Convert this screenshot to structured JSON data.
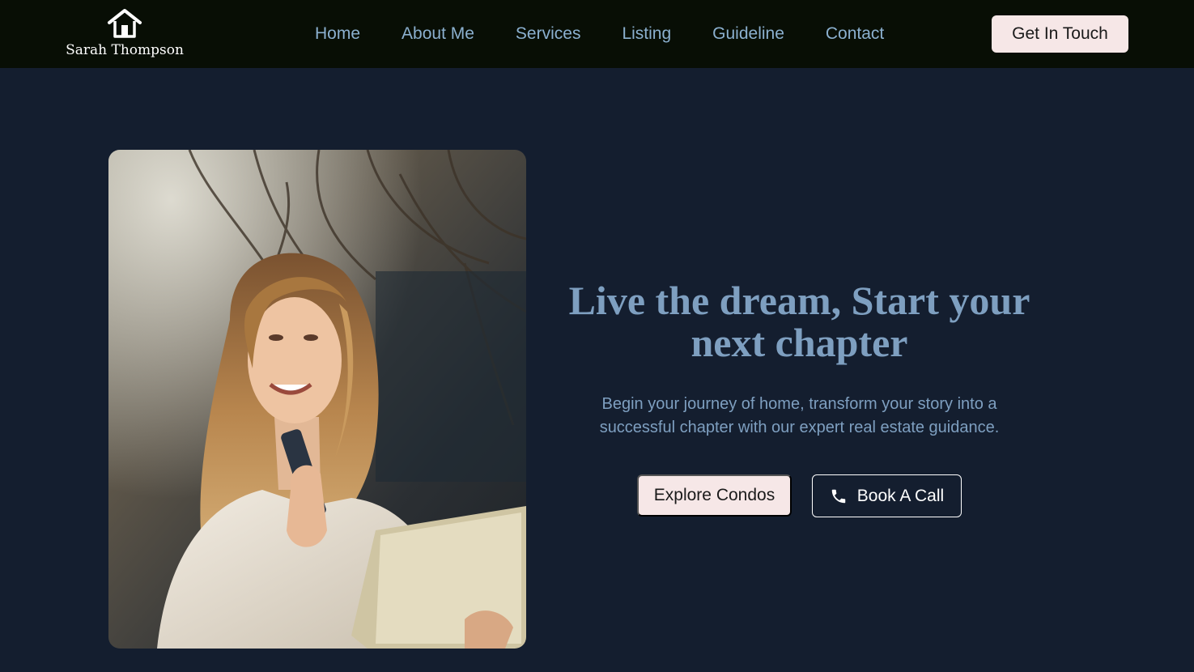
{
  "brand": {
    "name": "Sarah Thompson",
    "icon": "house-icon"
  },
  "nav": {
    "items": [
      {
        "label": "Home"
      },
      {
        "label": "About Me"
      },
      {
        "label": "Services"
      },
      {
        "label": "Listing"
      },
      {
        "label": "Guideline"
      },
      {
        "label": "Contact"
      }
    ],
    "cta_label": "Get In Touch"
  },
  "hero": {
    "title": "Live the dream, Start your next chapter",
    "subtitle": "Begin your journey of home, transform your story into a successful chapter with our expert real estate guidance.",
    "primary_button": "Explore Condos",
    "secondary_button": "Book A Call",
    "secondary_icon": "phone-icon",
    "image_subject": "smiling-woman-with-phone-and-tablet"
  },
  "colors": {
    "navbar_bg": "#080e05",
    "page_bg": "#141e2f",
    "accent_text": "#7e9fc0",
    "nav_text": "#8bb0cf",
    "button_bg": "#f6e7e7"
  }
}
